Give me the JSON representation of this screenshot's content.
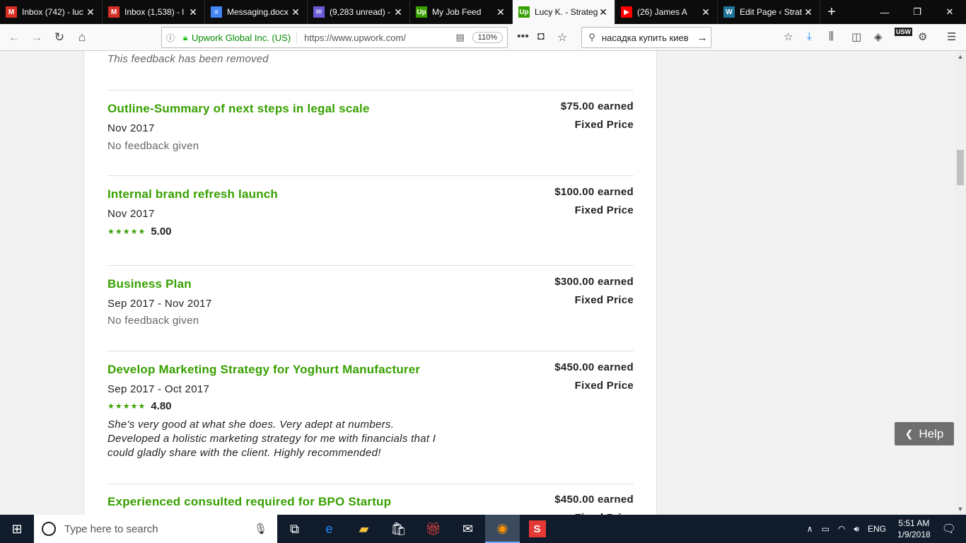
{
  "browser": {
    "tabs": [
      {
        "title": "Inbox (742) - luc",
        "icon": "gmail-icon",
        "color": "#d93025",
        "glyph": "M"
      },
      {
        "title": "Inbox (1,538) - l",
        "icon": "gmail-icon",
        "color": "#d93025",
        "glyph": "M"
      },
      {
        "title": "Messaging.docx",
        "icon": "docs-icon",
        "color": "#4285f4",
        "glyph": "≡"
      },
      {
        "title": "(9,283 unread) -",
        "icon": "mail-icon",
        "color": "#6b5bd6",
        "glyph": "✉"
      },
      {
        "title": "My Job Feed",
        "icon": "upwork-icon",
        "color": "#37a000",
        "glyph": "Up"
      },
      {
        "title": "Lucy K. - Strateg",
        "icon": "upwork-icon",
        "color": "#37a000",
        "glyph": "Up"
      },
      {
        "title": "(26) James A",
        "icon": "youtube-icon",
        "color": "#ff0000",
        "glyph": "▶"
      },
      {
        "title": "Edit Page ‹ Strat",
        "icon": "wordpress-icon",
        "color": "#21759b",
        "glyph": "W"
      }
    ],
    "active_tab": 5,
    "url_org": "Upwork Global Inc. (US)",
    "url": "https://www.upwork.com/",
    "zoom": "110%",
    "search_value": "насадка купить киев",
    "profile_badge": "USW"
  },
  "page": {
    "removed_note": "This feedback has been removed",
    "jobs": [
      {
        "title": "Outline-Summary of next steps in legal scale",
        "date": "Nov 2017",
        "feedback": "No feedback given",
        "earned": "$75.00 earned",
        "type": "Fixed Price"
      },
      {
        "title": "Internal brand refresh launch",
        "date": "Nov 2017",
        "rating": "5.00",
        "earned": "$100.00 earned",
        "type": "Fixed Price"
      },
      {
        "title": "Business Plan",
        "date": "Sep 2017 - Nov 2017",
        "feedback": "No feedback given",
        "earned": "$300.00 earned",
        "type": "Fixed Price"
      },
      {
        "title": "Develop Marketing Strategy for Yoghurt Manufacturer",
        "date": "Sep 2017 - Oct 2017",
        "rating": "4.80",
        "comment": "She's very good at what she does. Very adept at numbers. Developed a holistic marketing strategy for me with financials that I could gladly share with the client. Highly recommended!",
        "earned": "$450.00 earned",
        "type": "Fixed Price"
      },
      {
        "title": "Experienced consulted required for BPO Startup",
        "earned": "$450.00 earned",
        "type": "Fixed Price"
      }
    ],
    "help_label": "Help"
  },
  "taskbar": {
    "search_placeholder": "Type here to search",
    "lang": "ENG",
    "time": "5:51 AM",
    "date": "1/9/2018"
  }
}
